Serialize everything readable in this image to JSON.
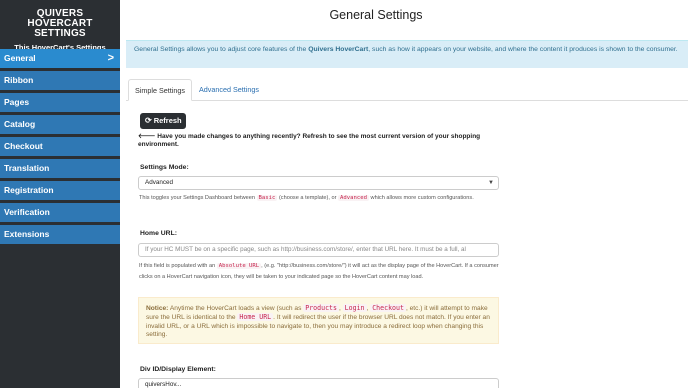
{
  "sidebar": {
    "title": "QUIVERS HOVERCART SETTINGS",
    "subtitle": "This HoverCart's Settings",
    "active_chevron": ">",
    "items": [
      {
        "label": "General",
        "active": true
      },
      {
        "label": "Ribbon"
      },
      {
        "label": "Pages"
      },
      {
        "label": "Catalog"
      },
      {
        "label": "Checkout"
      },
      {
        "label": "Translation"
      },
      {
        "label": "Registration"
      },
      {
        "label": "Verification"
      },
      {
        "label": "Extensions"
      }
    ]
  },
  "main": {
    "title": "General Settings",
    "info": {
      "prefix": "General Settings allows you to adjust core features of the ",
      "brand": "Quivers HoverCart",
      "suffix": ", such as how it appears on your website, and where the content it produces is shown to the consumer."
    },
    "tabs": [
      {
        "label": "Simple Settings",
        "active": true
      },
      {
        "label": "Advanced Settings"
      }
    ],
    "refresh": {
      "button_label": "Refresh",
      "icon": "refresh-icon",
      "note_arrow": "🡐",
      "note": "Have you made changes to anything recently? Refresh to see the most current version of your shopping environment."
    },
    "settings_mode": {
      "label": "Settings Mode:",
      "value": "Advanced",
      "help_1": "This toggles your Settings Dashboard between ",
      "code_1": "Basic",
      "help_2": " (choose a template), or ",
      "code_2": "Advanced",
      "help_3": " which allows more custom configurations."
    },
    "home_url": {
      "label": "Home URL:",
      "placeholder": "If your HC MUST be on a specific page, such as http://business.com/store/, enter that URL here. It must be a full, al",
      "help_1": "If this field is populated with an ",
      "code_1": "Absolute URL",
      "help_2": ", (e.g. \"http://business.com/store/\") it will act as the display page of the HoverCart. If a consumer clicks on a HoverCart navigation icon, they will be taken to your indicated page so the HoverCart content may load."
    },
    "notice": {
      "lead": "Notice:",
      "t1": " Anytime the HoverCart loads a view (such as ",
      "c1": "Products",
      "s1": ", ",
      "c2": "Login",
      "s2": ", ",
      "c3": "Checkout",
      "t2": ", etc.) it will attempt to make sure the URL is identical to the ",
      "c4": "Home URL",
      "t3": ". It will redirect the user if the browser URL does not match. If you enter an invalid URL, or a URL which is impossible to navigate to, then you may introduce a redirect loop when changing this setting."
    },
    "div_id": {
      "label": "Div ID/Display Element:",
      "value": "quiversHov..."
    }
  }
}
